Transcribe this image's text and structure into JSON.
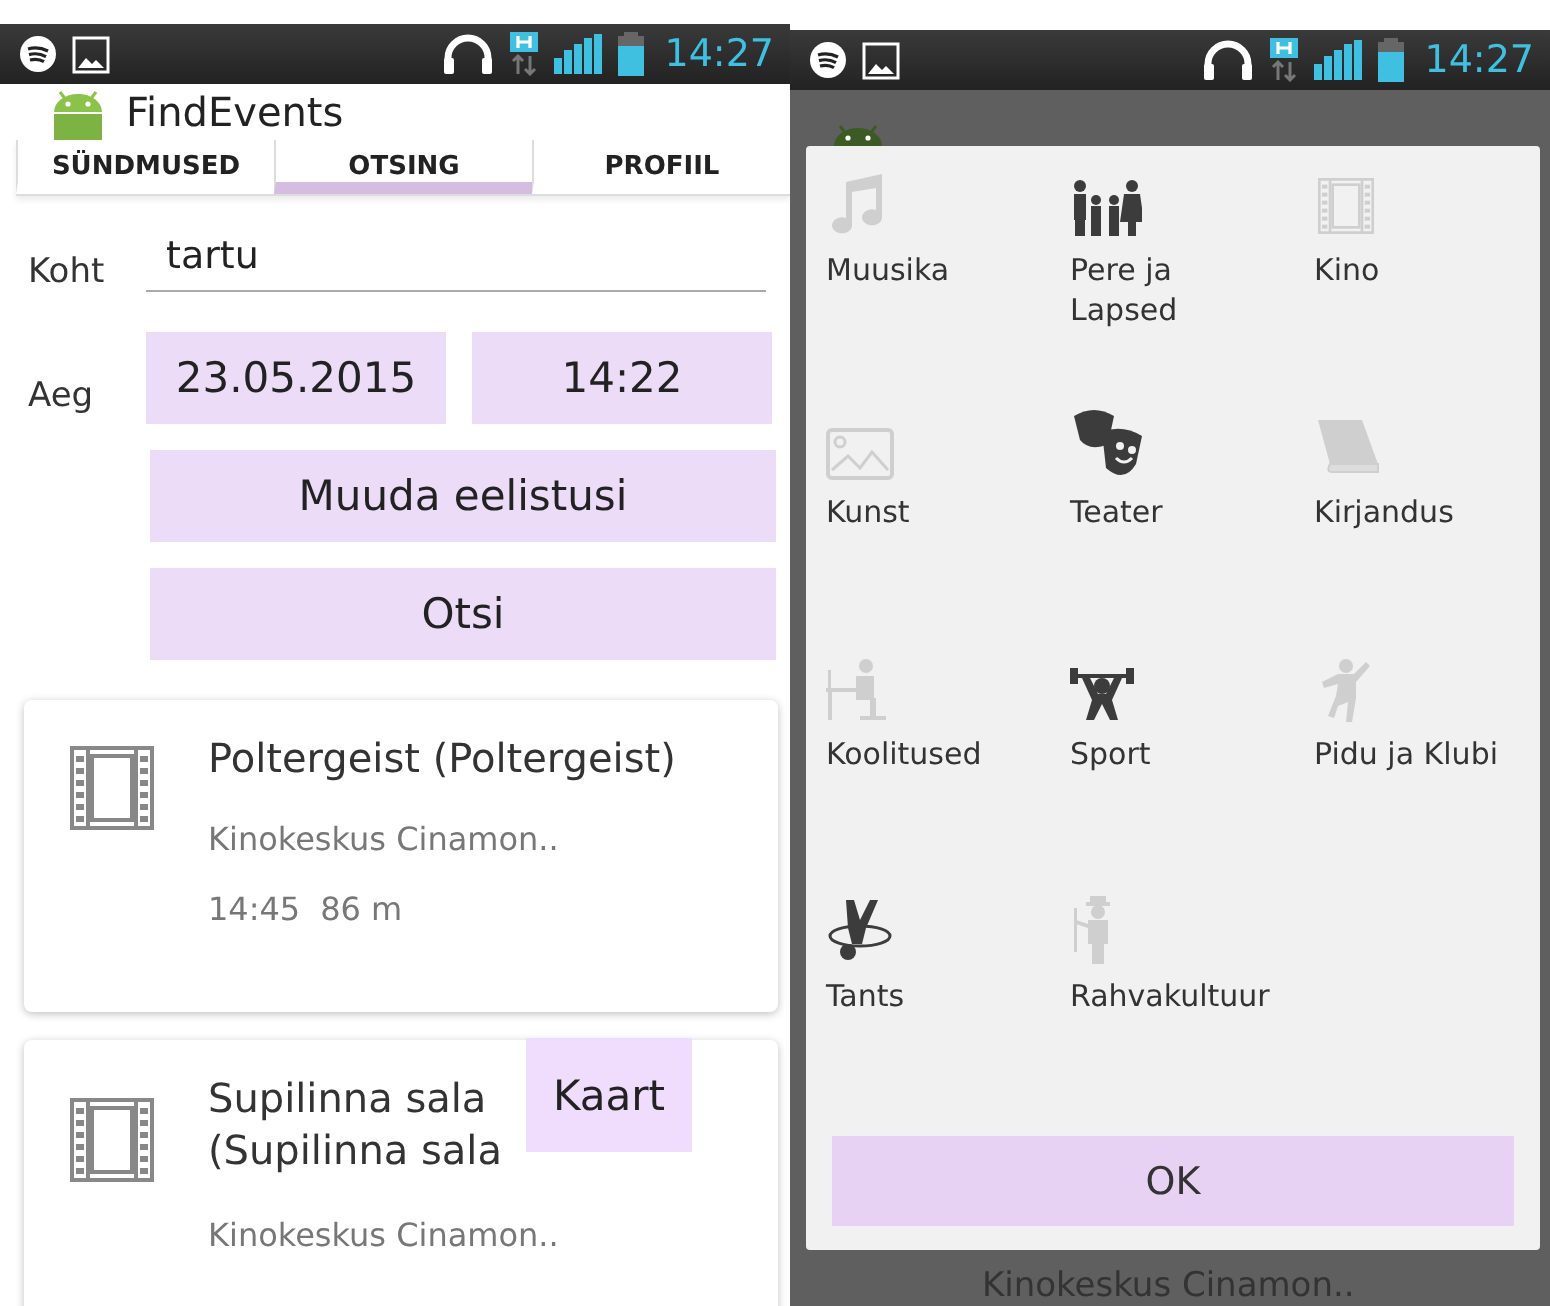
{
  "left_screen": {
    "status_bar": {
      "time": "14:27"
    },
    "app_bar": {
      "title": "FindEvents"
    },
    "tabs": [
      {
        "label": "SÜNDMUSED",
        "selected": false
      },
      {
        "label": "OTSING",
        "selected": true
      },
      {
        "label": "PROFIIL",
        "selected": false
      }
    ],
    "search": {
      "place_label": "Koht",
      "place_value": "tartu",
      "time_label": "Aeg",
      "date": "23.05.2015",
      "time": "14:22",
      "preferences_button": "Muuda eelistusi",
      "search_button": "Otsi"
    },
    "events": [
      {
        "title_lines": [
          "Poltergeist (Poltergeist)"
        ],
        "venue": "Kinokeskus Cinamon..",
        "time": "14:45",
        "distance": "86 m"
      },
      {
        "title_lines": [
          "Supilinna sala",
          "(Supilinna sala"
        ],
        "venue": "Kinokeskus Cinamon..",
        "map_button": "Kaart"
      }
    ]
  },
  "right_screen": {
    "status_bar": {
      "time": "14:27"
    },
    "background": {
      "venue": "Kinokeskus Cinamon.."
    },
    "dialog": {
      "categories": [
        {
          "label": "Muusika",
          "selected": false
        },
        {
          "label": "Pere ja Lapsed",
          "selected": true
        },
        {
          "label": "Kino",
          "selected": false
        },
        {
          "label": "Kunst",
          "selected": false
        },
        {
          "label": "Teater",
          "selected": true
        },
        {
          "label": "Kirjandus",
          "selected": false
        },
        {
          "label": "Koolitused",
          "selected": false
        },
        {
          "label": "Sport",
          "selected": true
        },
        {
          "label": "Pidu ja Klubi",
          "selected": false
        },
        {
          "label": "Tants",
          "selected": true
        },
        {
          "label": "Rahvakultuur",
          "selected": false
        }
      ],
      "ok_button": "OK"
    }
  }
}
